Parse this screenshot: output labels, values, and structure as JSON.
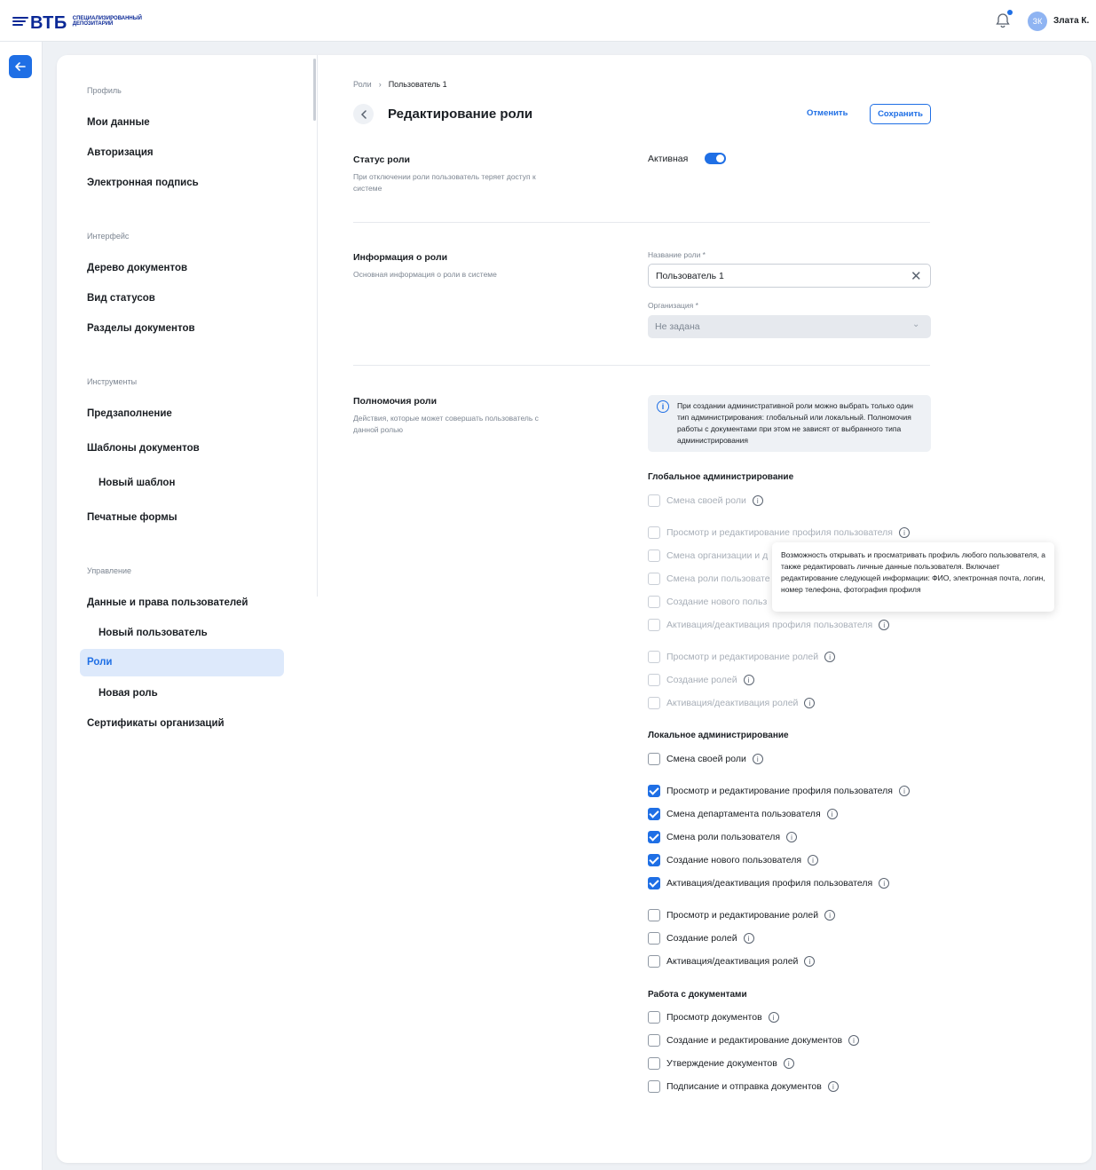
{
  "header": {
    "logo_text": "ВТБ",
    "logo_sub": "Специализированный депозитарий",
    "avatar_initials": "ЗК",
    "user_name": "Злата К."
  },
  "sidebar": {
    "sections": [
      {
        "title": "Профиль",
        "items": [
          "Мои данные",
          "Авторизация",
          "Электронная подпись"
        ]
      },
      {
        "title": "Интерфейс",
        "items": [
          "Дерево документов",
          "Вид статусов",
          "Разделы документов"
        ]
      },
      {
        "title": "Инструменты",
        "items": [
          "Предзаполнение",
          "Шаблоны документов",
          "Новый шаблон",
          "Печатные формы"
        ]
      },
      {
        "title": "Управление",
        "items": [
          "Данные и права пользователей",
          "Новый пользователь",
          "Роли",
          "Новая роль",
          "Сертификаты организаций"
        ]
      }
    ]
  },
  "breadcrumb": {
    "root": "Роли",
    "sep": "›",
    "current": "Пользователь 1"
  },
  "page_title": "Редактирование роли",
  "actions": {
    "cancel": "Отменить",
    "save": "Сохранить"
  },
  "status_section": {
    "title": "Статус роли",
    "desc": "При отключении роли пользователь теряет доступ к системе",
    "toggle_label": "Активная"
  },
  "info_section": {
    "title": "Информация о роли",
    "desc": "Основная информация о роли в системе",
    "name_label": "Название роли *",
    "name_value": "Пользователь 1",
    "org_label": "Организация *",
    "org_value": "Не задана"
  },
  "perm_section": {
    "title": "Полномочия роли",
    "desc": "Действия, которые может совершать пользователь с данной ролью",
    "info": "При создании административной роли можно выбрать только один тип администрирования: глобальный или локальный. Полномочия работы с документами при этом не зависят от выбранного типа администрирования"
  },
  "global_admin": {
    "title": "Глобальное администрирование",
    "items": [
      "Смена своей роли",
      "Просмотр и редактирование профиля пользователя",
      "Смена организации и д",
      "Смена роли пользовате",
      "Создание нового польз",
      "Активация/деактивация профиля пользователя",
      "Просмотр и редактирование ролей",
      "Создание ролей",
      "Активация/деактивация ролей"
    ]
  },
  "local_admin": {
    "title": "Локальное администрирование",
    "items": [
      "Смена своей роли",
      "Просмотр и редактирование профиля пользователя",
      "Смена департамента пользователя",
      "Смена роли пользователя",
      "Создание нового пользователя",
      "Активация/деактивация профиля пользователя",
      "Просмотр и редактирование ролей",
      "Создание ролей",
      "Активация/деактивация ролей"
    ]
  },
  "docs": {
    "title": "Работа с документами",
    "items": [
      "Просмотр документов",
      "Создание и редактирование документов",
      "Утверждение документов",
      "Подписание и отправка документов"
    ]
  },
  "tooltip": "Возможность открывать и просматривать профиль любого пользователя, а также редактировать личные данные пользователя. Включает редактирование следующей информации: ФИО, электронная почта, логин, номер телефона, фотография профиля",
  "colors": {
    "accent": "#1f6fe5",
    "brand": "#0a2896",
    "active_bg": "#dde9fb"
  }
}
